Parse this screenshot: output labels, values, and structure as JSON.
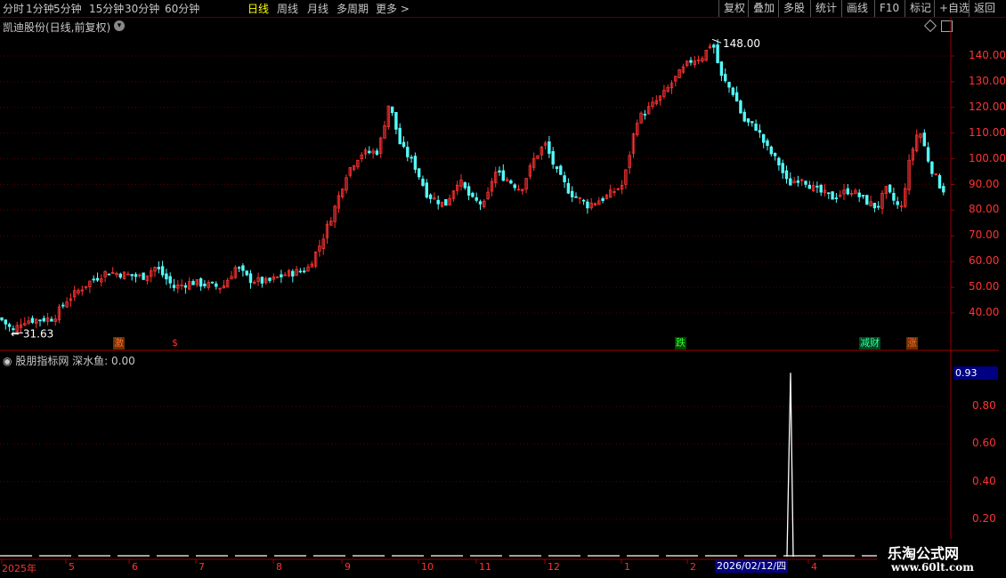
{
  "toolbar": {
    "left": [
      "分时",
      "1分钟",
      "5分钟",
      "15分钟",
      "30分钟",
      "60分钟",
      "日线",
      "周线",
      "月线",
      "多周期",
      "更多 >"
    ],
    "active": "日线",
    "right": [
      "复权",
      "叠加",
      "多股",
      "统计",
      "画线",
      "F10",
      "标记",
      "+自选",
      "返回"
    ]
  },
  "stock": {
    "title": "凯迪股份(日线,前复权)"
  },
  "price_axis": {
    "labels": [
      "140.00",
      "130.00",
      "120.00",
      "110.00",
      "100.00",
      "90.00",
      "80.00",
      "70.00",
      "60.00",
      "50.00",
      "40.00"
    ]
  },
  "annotations": {
    "high": "148.00",
    "low": "31.63"
  },
  "signals": [
    {
      "text": "激",
      "color": "#ff6633",
      "bg": "#663300"
    },
    {
      "text": "$",
      "color": "#ff3030",
      "bg": ""
    },
    {
      "text": "跌",
      "color": "#33ff33",
      "bg": "#004400"
    },
    {
      "text": "减财",
      "color": "#33ff99",
      "bg": "#004422"
    },
    {
      "text": "涨",
      "color": "#ff6633",
      "bg": "#663300"
    }
  ],
  "indicator": {
    "source": "股朋指标网",
    "name": "深水鱼: 0.00",
    "value_box": "0.93",
    "axis_labels": [
      "0.80",
      "0.60",
      "0.40",
      "0.20"
    ]
  },
  "date_axis": {
    "labels": [
      "2025年",
      "5",
      "6",
      "7",
      "8",
      "9",
      "10",
      "11",
      "12",
      "1",
      "2",
      "4"
    ],
    "cursor": "2026/02/12/四"
  },
  "watermark": {
    "line1": "乐淘公式网",
    "line2": "www.60lt.com"
  },
  "colors": {
    "up": "#ff3232",
    "down": "#54fcfc",
    "grid": "#5a0000"
  }
}
